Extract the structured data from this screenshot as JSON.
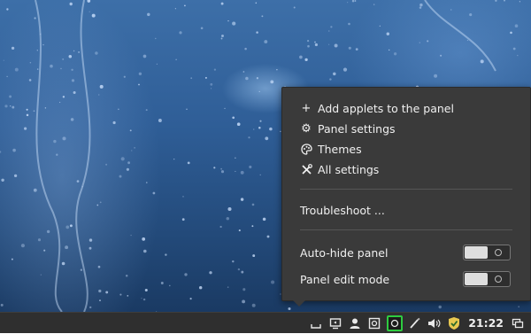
{
  "menu": {
    "items": [
      {
        "label": "Add applets to the panel",
        "icon": "plus-icon"
      },
      {
        "label": "Panel settings",
        "icon": "gear-icon"
      },
      {
        "label": "Themes",
        "icon": "palette-icon"
      },
      {
        "label": "All settings",
        "icon": "tools-icon"
      }
    ],
    "troubleshoot_label": "Troubleshoot ...",
    "toggles": [
      {
        "label": "Auto-hide panel",
        "state": "off"
      },
      {
        "label": "Panel edit mode",
        "state": "off"
      }
    ]
  },
  "panel": {
    "clock": "21:22",
    "tray_icons": [
      "show-desktop-icon",
      "display-icon",
      "user-icon",
      "updates-icon",
      "network-icon",
      "brush-icon",
      "volume-icon",
      "shield-icon",
      "window-list-icon"
    ],
    "accent_color": "#2ecc40"
  }
}
